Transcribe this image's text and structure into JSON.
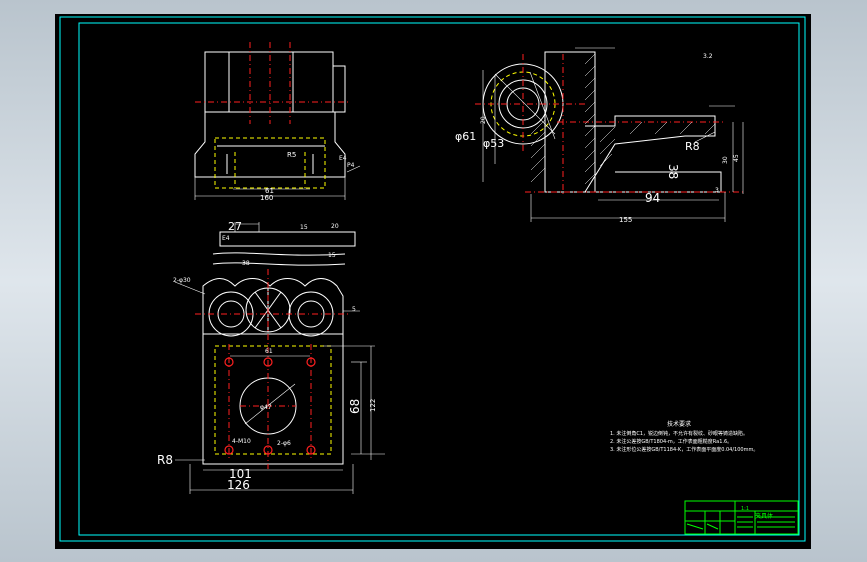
{
  "drawing": {
    "colors": {
      "frame": "#00ffff",
      "outline": "#ffffff",
      "centerline": "#ff2020",
      "hidden": "#ffff00",
      "title_block": "#00ff00",
      "background": "#000000"
    },
    "top_view": {
      "dims": {
        "overall": "160",
        "inner": "61",
        "r_small": "R5",
        "e4": "E4",
        "p4": "P4"
      }
    },
    "front_view": {
      "dims": {
        "d27": "27",
        "e4": "E4",
        "d15a": "15",
        "d38": "38",
        "d15b": "15",
        "d20": "20",
        "holes": "2-φ30",
        "d5": "5",
        "d61": "61",
        "d68": "68",
        "d122": "122",
        "r8": "R8",
        "m10": "4-M10",
        "pins": "2-φ6",
        "d101": "101",
        "d126": "126",
        "d47": "φ47",
        "d17": "17"
      }
    },
    "side_view": {
      "dims": {
        "d61": "φ61",
        "d53": "φ53",
        "r8": "R8",
        "d38": "38",
        "d94": "94",
        "d155": "155",
        "d30": "30",
        "d3": "3",
        "d45": "45",
        "d20": "20",
        "ra": "3.2"
      }
    },
    "notes": {
      "title": "技术要求",
      "lines": [
        "1. 未注倒角C1，锐边倒钝，不允许有裂纹、砂眼等铸造缺陷。",
        "2. 未注公差按GB/T1804-m，工作表面粗糙度Ra1.6。",
        "3. 未注形位公差按GB/T1184-K，工作表面平面度0.04/100mm。"
      ]
    },
    "title_block": {
      "part_label": "夹具体",
      "scale": "1:1"
    }
  }
}
